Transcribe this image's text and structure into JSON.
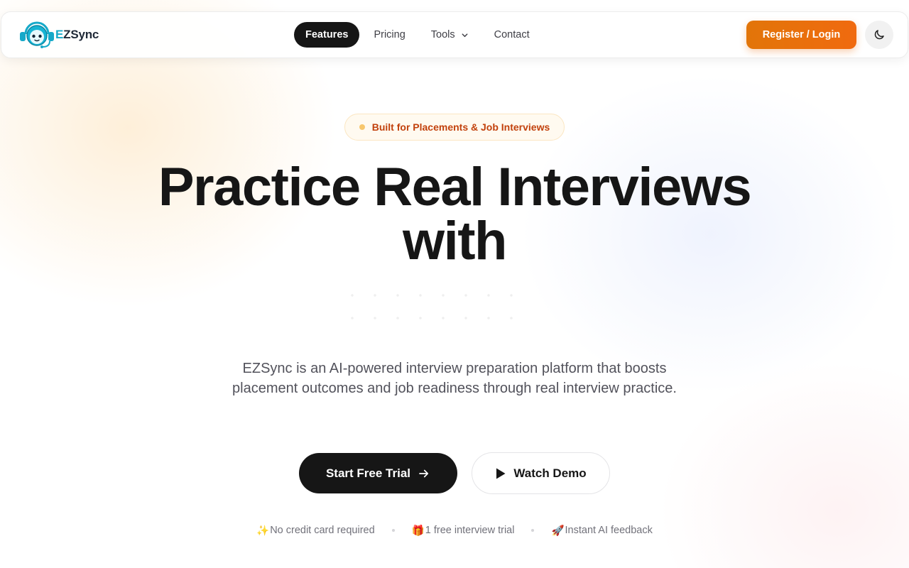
{
  "brand": {
    "name_accent": "E",
    "name_rest": "ZSync"
  },
  "nav": {
    "links": [
      {
        "label": "Features",
        "active": true
      },
      {
        "label": "Pricing"
      },
      {
        "label": "Tools",
        "has_dropdown": true
      },
      {
        "label": "Contact"
      }
    ],
    "register_label": "Register / Login",
    "theme_toggle_icon": "moon-icon"
  },
  "hero": {
    "badge": "Built for Placements & Job Interviews",
    "headline_line1": "Practice Real Interviews",
    "headline_line2": "with",
    "description": "EZSync is an AI-powered interview preparation platform that boosts placement outcomes and job readiness through real interview practice.",
    "primary_cta": "Start Free Trial",
    "secondary_cta": "Watch Demo"
  },
  "perks": [
    {
      "icon": "✨",
      "label": "No credit card required"
    },
    {
      "icon": "🎁",
      "label": "1 free interview trial"
    },
    {
      "icon": "🚀",
      "label": "Instant AI feedback"
    }
  ],
  "colors": {
    "accent_orange": "#E8700C",
    "dark": "#161616",
    "badge_text": "#C2410C",
    "logo_teal": "#16A9C9"
  }
}
